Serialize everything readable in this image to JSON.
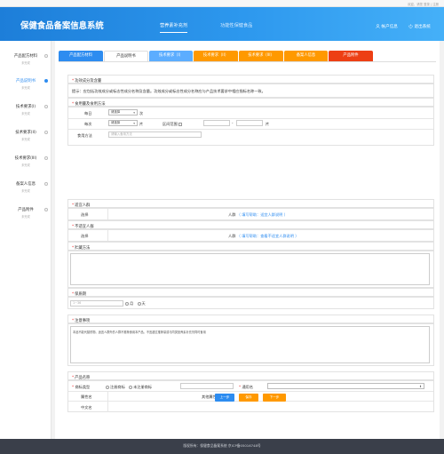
{
  "topbar": {
    "links": "欢迎，请您 登录 | 注册"
  },
  "header": {
    "title": "保健食品备案信息系统",
    "nav_active": "营养素补充剂",
    "nav_other": "功能性保健食品",
    "account": "帐户信息",
    "logout": "退出系统"
  },
  "sidebar": {
    "items": [
      {
        "label": "产品配方材料",
        "sub": "未完成"
      },
      {
        "label": "产品说明书",
        "sub": "未完成"
      },
      {
        "label": "技术要求(I)",
        "sub": "未完成"
      },
      {
        "label": "技术要求(II)",
        "sub": "未完成"
      },
      {
        "label": "技术要求(III)",
        "sub": "未完成"
      },
      {
        "label": "备案人信息",
        "sub": "未完成"
      },
      {
        "label": "产品附件",
        "sub": "未完成"
      }
    ]
  },
  "tabs": [
    {
      "label": "产品配方材料",
      "color": "#2d8cf0"
    },
    {
      "label": "产品说明书",
      "color": "#ffffff"
    },
    {
      "label": "技术要求（I）",
      "color": "#5cadff"
    },
    {
      "label": "技术要求（II）",
      "color": "#ff9900"
    },
    {
      "label": "技术要求（III）",
      "color": "#ff9900"
    },
    {
      "label": "备案人信息",
      "color": "#ff9900"
    },
    {
      "label": "产品附件",
      "color": "#ed3f14"
    }
  ],
  "form": {
    "ingredient": {
      "title": "功效成分及含量",
      "hint": "提示：应包括功效成分或标志性成分名称及含量。功效成分或标志性成分名称应与产品技术要求中相应指标名称一致。"
    },
    "dosage": {
      "title": "食用量及食用方法",
      "daily_label": "每日",
      "daily_select": "请选择",
      "daily_unit": "次",
      "per_label": "每次",
      "per_select": "请选择",
      "per_unit": "片",
      "range_label": "区间范围",
      "range_dash": "-",
      "range_unit": "片",
      "method_label": "食用方法",
      "method_placeholder": "请输入食用方法"
    },
    "suitable": {
      "title": "适宜人群",
      "choose_label": "选择",
      "value": "人群",
      "help": "（ 填写帮助：适宜人群说明 ）"
    },
    "unsuitable": {
      "title": "不适宜人群",
      "choose_label": "选择",
      "value": "人群",
      "help": "（ 填写帮助：查看不适宜人群说明 ）"
    },
    "storage": {
      "title": "贮藏方法"
    },
    "shelf": {
      "title": "保质期",
      "placeholder": "1~36",
      "opt_month": "月",
      "opt_day": "天"
    },
    "notes": {
      "title": "注意事项",
      "text": "本品不能代替药物。适宜人群外的人群不推荐食用本产品。不宜超过推荐量或与同类营养素补充剂同时食用"
    },
    "product_name": {
      "title": "产品名称",
      "brand_type_label": "商标类型",
      "opt_registered": "注册商标",
      "opt_unregistered": "未注册商标",
      "common_name_label": "通用名",
      "attr_name_label": "属性名",
      "other_attr_label": "其他属性",
      "cn_name_label": "中文名"
    }
  },
  "buttons": {
    "prev": "上一步",
    "save": "保存",
    "next": "下一步"
  },
  "footer": {
    "text": "版权所有：保健食品备案系统 京ICP备05016748号"
  }
}
